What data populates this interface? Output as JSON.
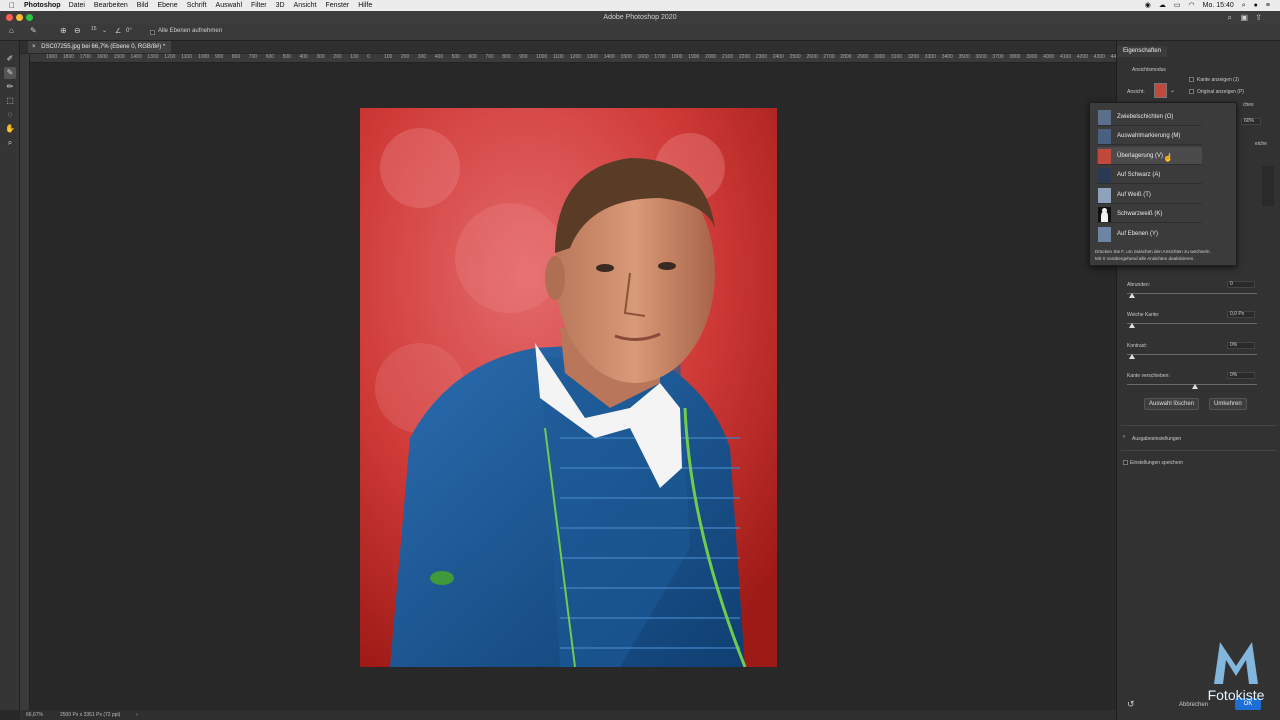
{
  "menubar": {
    "app": "Photoshop",
    "items": [
      "Datei",
      "Bearbeiten",
      "Bild",
      "Ebene",
      "Schrift",
      "Auswahl",
      "Filter",
      "3D",
      "Ansicht",
      "Fenster",
      "Hilfe"
    ],
    "clock": "Mo. 15:40"
  },
  "window": {
    "title": "Adobe Photoshop 2020"
  },
  "options": {
    "brush_size": "15",
    "angle": "0°",
    "sample_all": "Alle Ebenen aufnehmen"
  },
  "document": {
    "tab": "DSC07255.jpg bei 66,7% (Ebene 0, RGB/8#) *"
  },
  "ruler": {
    "labels": [
      "1900",
      "1800",
      "1700",
      "1600",
      "1500",
      "1400",
      "1300",
      "1200",
      "1100",
      "1000",
      "900",
      "800",
      "700",
      "600",
      "500",
      "400",
      "300",
      "200",
      "100",
      "0",
      "100",
      "200",
      "300",
      "400",
      "500",
      "600",
      "700",
      "800",
      "900",
      "1000",
      "1100",
      "1200",
      "1300",
      "1400",
      "1500",
      "1600",
      "1700",
      "1800",
      "1900",
      "2000",
      "2100",
      "2200",
      "2300",
      "2400",
      "2500",
      "2600",
      "2700",
      "2800",
      "2900",
      "3000",
      "3100",
      "3200",
      "3300",
      "3400",
      "3500",
      "3600",
      "3700",
      "3800",
      "3900",
      "4000",
      "4100",
      "4200",
      "4300",
      "4400"
    ]
  },
  "status": {
    "zoom": "66,67%",
    "size": "2500 Px x 3351 Px (72 ppi)"
  },
  "panel": {
    "tab": "Eigenschaften",
    "view_mode": "Ansichtsmodus",
    "view_label": "Ansicht:",
    "show_edge": "Kante anzeigen (J)",
    "show_original": "Original anzeigen (P)",
    "partial_ches": "ches",
    "partial_pct": "60%",
    "partial_eiche": "eiche",
    "smooth": {
      "label": "Abrunden:",
      "value": "0"
    },
    "feather": {
      "label": "Weiche Kante:",
      "value": "0,0 Px"
    },
    "contrast": {
      "label": "Kontrast:",
      "value": "0%"
    },
    "shift_edge": {
      "label": "Kante verschieben:",
      "value": "0%"
    },
    "clear_selection": "Auswahl löschen",
    "invert": "Umkehren",
    "output_settings": "Ausgabeeinstellungen",
    "remember_settings": "Einstellungen speichern",
    "cancel": "Abbrechen",
    "ok": "OK"
  },
  "dropdown": {
    "items": [
      {
        "label": "Zwiebelschichten (O)",
        "thumb": "#5b6f8a"
      },
      {
        "label": "Auswahlmarkierung (M)",
        "thumb": "#4a6080"
      },
      {
        "label": "Überlagerung (V)",
        "thumb": "#c0483c"
      },
      {
        "label": "Auf Schwarz (A)",
        "thumb": "#2a3a52"
      },
      {
        "label": "Auf Weiß (T)",
        "thumb": "#8fa2bb"
      },
      {
        "label": "Schwarzweiß (K)",
        "thumb": "#f2f2f2"
      },
      {
        "label": "Auf Ebenen (Y)",
        "thumb": "#6d84a3"
      }
    ],
    "help_line1": "Drücken Sie F, um zwischen den Ansichten zu wechseln.",
    "help_line2": "Mit X vorübergehend alle Ansichten deaktivieren."
  },
  "logo": {
    "text": "Fotokiste"
  },
  "colors": {
    "accent": "#3b8fd6",
    "overlay_red": "#c7302b",
    "jacket": "#1d5a96"
  }
}
